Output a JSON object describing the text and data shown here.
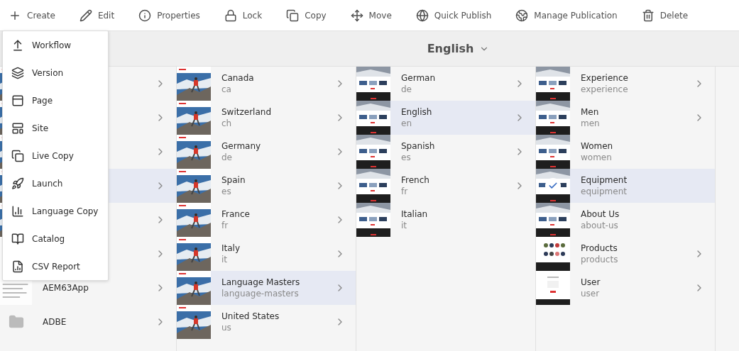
{
  "toolbar": [
    {
      "label": "Create"
    },
    {
      "label": "Edit"
    },
    {
      "label": "Properties"
    },
    {
      "label": "Lock"
    },
    {
      "label": "Copy"
    },
    {
      "label": "Move"
    },
    {
      "label": "Quick Publish"
    },
    {
      "label": "Manage Publication"
    },
    {
      "label": "Delete"
    }
  ],
  "create_menu": [
    {
      "label": "Workflow"
    },
    {
      "label": "Version"
    },
    {
      "label": "Page"
    },
    {
      "label": "Site"
    },
    {
      "label": "Live Copy"
    },
    {
      "label": "Launch"
    },
    {
      "label": "Language Copy"
    },
    {
      "label": "Catalog"
    },
    {
      "label": "CSV Report"
    }
  ],
  "header": {
    "title": "English"
  },
  "columns": [
    {
      "items": [
        {
          "kind": "hiker",
          "selected": false,
          "has_children": true
        },
        {
          "kind": "hiker",
          "selected": false,
          "has_children": true
        },
        {
          "kind": "hiker",
          "selected": false,
          "has_children": true
        },
        {
          "kind": "hiker",
          "selected": true,
          "has_children": true
        },
        {
          "kind": "hiker",
          "selected": false,
          "has_children": true
        },
        {
          "kind": "doc",
          "selected": false,
          "has_children": true
        },
        {
          "title": "AEM63App",
          "kind": "doc",
          "selected": false,
          "has_children": true
        },
        {
          "title": "ADBE",
          "kind": "folder",
          "selected": false,
          "has_children": true
        }
      ]
    },
    {
      "items": [
        {
          "title": "Canada",
          "name": "ca",
          "kind": "hiker",
          "selected": false,
          "has_children": true
        },
        {
          "title": "Switzerland",
          "name": "ch",
          "kind": "hiker",
          "selected": false,
          "has_children": true
        },
        {
          "title": "Germany",
          "name": "de",
          "kind": "hiker",
          "selected": false,
          "has_children": true
        },
        {
          "title": "Spain",
          "name": "es",
          "kind": "hiker",
          "selected": false,
          "has_children": true
        },
        {
          "title": "France",
          "name": "fr",
          "kind": "hiker",
          "selected": false,
          "has_children": true
        },
        {
          "title": "Italy",
          "name": "it",
          "kind": "hiker",
          "selected": false,
          "has_children": true
        },
        {
          "title": "Language Masters",
          "name": "language-masters",
          "kind": "hiker",
          "selected": true,
          "has_children": true
        },
        {
          "title": "United States",
          "name": "us",
          "kind": "hiker",
          "selected": false,
          "has_children": true
        }
      ]
    },
    {
      "items": [
        {
          "title": "German",
          "name": "de",
          "kind": "site",
          "selected": false,
          "has_children": true
        },
        {
          "title": "English",
          "name": "en",
          "kind": "site",
          "selected": true,
          "has_children": true
        },
        {
          "title": "Spanish",
          "name": "es",
          "kind": "site",
          "selected": false,
          "has_children": true
        },
        {
          "title": "French",
          "name": "fr",
          "kind": "site",
          "selected": false,
          "has_children": true
        },
        {
          "title": "Italian",
          "name": "it",
          "kind": "site",
          "selected": false,
          "has_children": false
        }
      ]
    },
    {
      "items": [
        {
          "title": "Experience",
          "name": "experience",
          "kind": "site",
          "selected": false,
          "checked": false,
          "has_children": true
        },
        {
          "title": "Men",
          "name": "men",
          "kind": "site",
          "selected": false,
          "checked": false,
          "has_children": true
        },
        {
          "title": "Women",
          "name": "women",
          "kind": "site",
          "selected": false,
          "checked": false,
          "has_children": false
        },
        {
          "title": "Equipment",
          "name": "equipment",
          "kind": "site",
          "selected": true,
          "checked": true,
          "has_children": false
        },
        {
          "title": "About Us",
          "name": "about-us",
          "kind": "site",
          "selected": false,
          "checked": false,
          "has_children": false
        },
        {
          "title": "Products",
          "name": "products",
          "kind": "products",
          "selected": false,
          "checked": false,
          "has_children": true
        },
        {
          "title": "User",
          "name": "user",
          "kind": "user",
          "selected": false,
          "checked": false,
          "has_children": true
        }
      ]
    }
  ]
}
